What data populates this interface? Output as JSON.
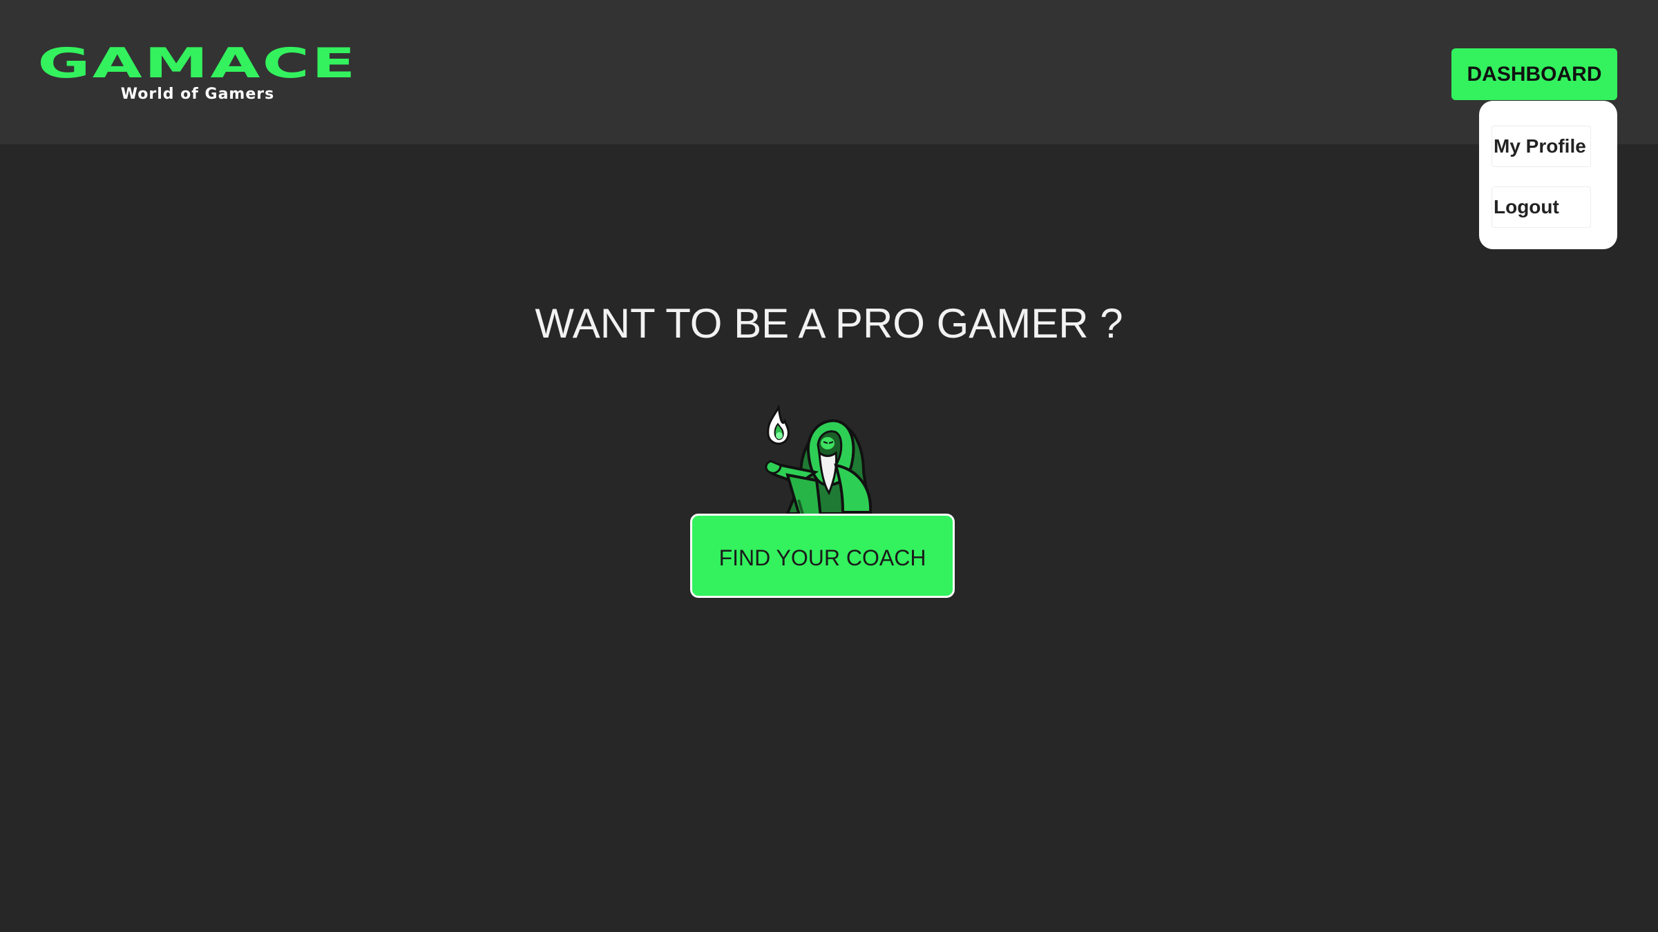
{
  "header": {
    "logo_title": "GAMACE",
    "logo_subtitle": "World of Gamers",
    "dashboard_label": "DASHBOARD"
  },
  "dropdown": {
    "items": [
      {
        "label": "My Profile"
      },
      {
        "label": "Logout"
      }
    ]
  },
  "hero": {
    "title": "WANT TO BE A PRO GAMER ?",
    "mascot": "green-hooded-wizard-mascot",
    "cta_label": "FIND YOUR COACH"
  },
  "colors": {
    "accent": "#33f25e",
    "background": "#272727",
    "header_bg": "#333333"
  }
}
